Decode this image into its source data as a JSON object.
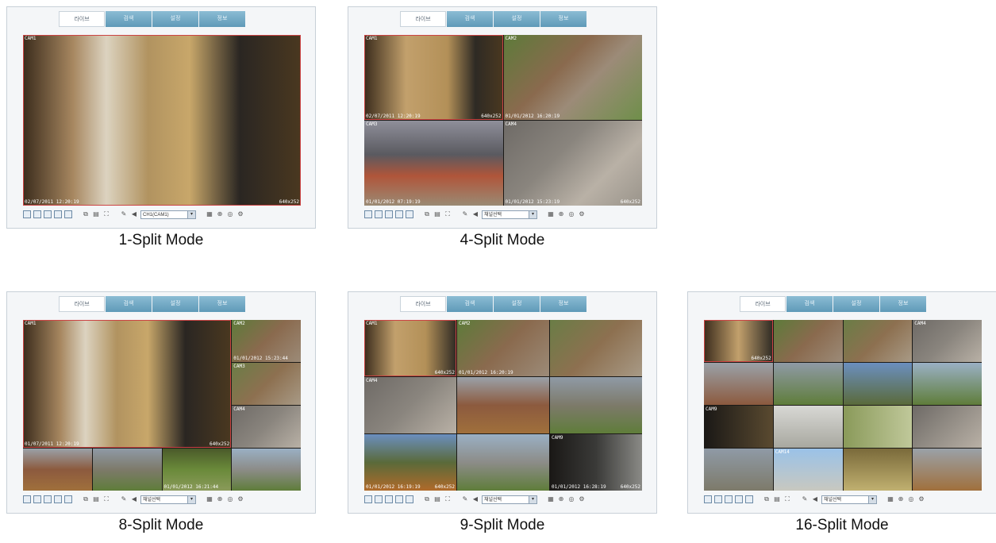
{
  "nav_tabs": [
    "라이브",
    "검색",
    "설정",
    "정보"
  ],
  "panels": [
    {
      "caption": "1-Split Mode",
      "cells": [
        {
          "label": "CAM1",
          "timestamp": "02/07/2011 12:20:19",
          "resolution": "640x252"
        }
      ],
      "camera_select": "CH1(CAM1)"
    },
    {
      "caption": "4-Split Mode",
      "cells": [
        {
          "label": "CAM1",
          "timestamp": "02/07/2011 12:20:19",
          "resolution": "640x252"
        },
        {
          "label": "CAM2",
          "timestamp": "01/01/2012 16:20:19",
          "resolution": ""
        },
        {
          "label": "CAM3",
          "timestamp": "01/01/2012 07:19:19",
          "resolution": ""
        },
        {
          "label": "CAM4",
          "timestamp": "01/01/2012 15:23:19",
          "resolution": "640x252"
        }
      ],
      "camera_select": "채널선택"
    },
    {
      "caption": "8-Split Mode",
      "cells": [
        {
          "label": "CAM1",
          "timestamp": "01/07/2011 12:20:19",
          "resolution": "640x252"
        },
        {
          "label": "CAM2",
          "timestamp": "01/01/2012 15:23:44",
          "resolution": ""
        },
        {
          "label": "CAM3",
          "timestamp": "",
          "resolution": ""
        },
        {
          "label": "CAM4",
          "timestamp": "",
          "resolution": ""
        },
        {
          "label": "",
          "timestamp": "",
          "resolution": ""
        },
        {
          "label": "",
          "timestamp": "",
          "resolution": ""
        },
        {
          "label": "",
          "timestamp": "01/01/2012 16:21:44",
          "resolution": ""
        },
        {
          "label": "",
          "timestamp": "",
          "resolution": ""
        }
      ],
      "camera_select": "채널선택"
    },
    {
      "caption": "9-Split Mode",
      "cells": [
        {
          "label": "CAM1",
          "timestamp": "",
          "resolution": "640x252"
        },
        {
          "label": "CAM2",
          "timestamp": "01/01/2012 16:20:19",
          "resolution": ""
        },
        {
          "label": "",
          "timestamp": "",
          "resolution": ""
        },
        {
          "label": "CAM4",
          "timestamp": "",
          "resolution": ""
        },
        {
          "label": "",
          "timestamp": "",
          "resolution": ""
        },
        {
          "label": "",
          "timestamp": "",
          "resolution": ""
        },
        {
          "label": "",
          "timestamp": "01/01/2012 16:19:19",
          "resolution": "640x252"
        },
        {
          "label": "",
          "timestamp": "",
          "resolution": ""
        },
        {
          "label": "CAM9",
          "timestamp": "01/01/2012 16:28:19",
          "resolution": "640x252"
        }
      ],
      "camera_select": "채널선택"
    },
    {
      "caption": "16-Split Mode",
      "cells": [
        {
          "label": "",
          "timestamp": "",
          "resolution": "640x252"
        },
        {
          "label": "",
          "timestamp": "",
          "resolution": ""
        },
        {
          "label": "",
          "timestamp": "",
          "resolution": ""
        },
        {
          "label": "CAM4",
          "timestamp": "",
          "resolution": ""
        },
        {
          "label": "",
          "timestamp": "",
          "resolution": ""
        },
        {
          "label": "",
          "timestamp": "",
          "resolution": ""
        },
        {
          "label": "",
          "timestamp": "",
          "resolution": ""
        },
        {
          "label": "",
          "timestamp": "",
          "resolution": ""
        },
        {
          "label": "CAM9",
          "timestamp": "",
          "resolution": ""
        },
        {
          "label": "",
          "timestamp": "",
          "resolution": ""
        },
        {
          "label": "",
          "timestamp": "",
          "resolution": ""
        },
        {
          "label": "",
          "timestamp": "",
          "resolution": ""
        },
        {
          "label": "",
          "timestamp": "",
          "resolution": ""
        },
        {
          "label": "CAM14",
          "timestamp": "",
          "resolution": ""
        },
        {
          "label": "",
          "timestamp": "",
          "resolution": ""
        },
        {
          "label": "",
          "timestamp": "",
          "resolution": ""
        }
      ],
      "camera_select": "채널선택"
    }
  ]
}
